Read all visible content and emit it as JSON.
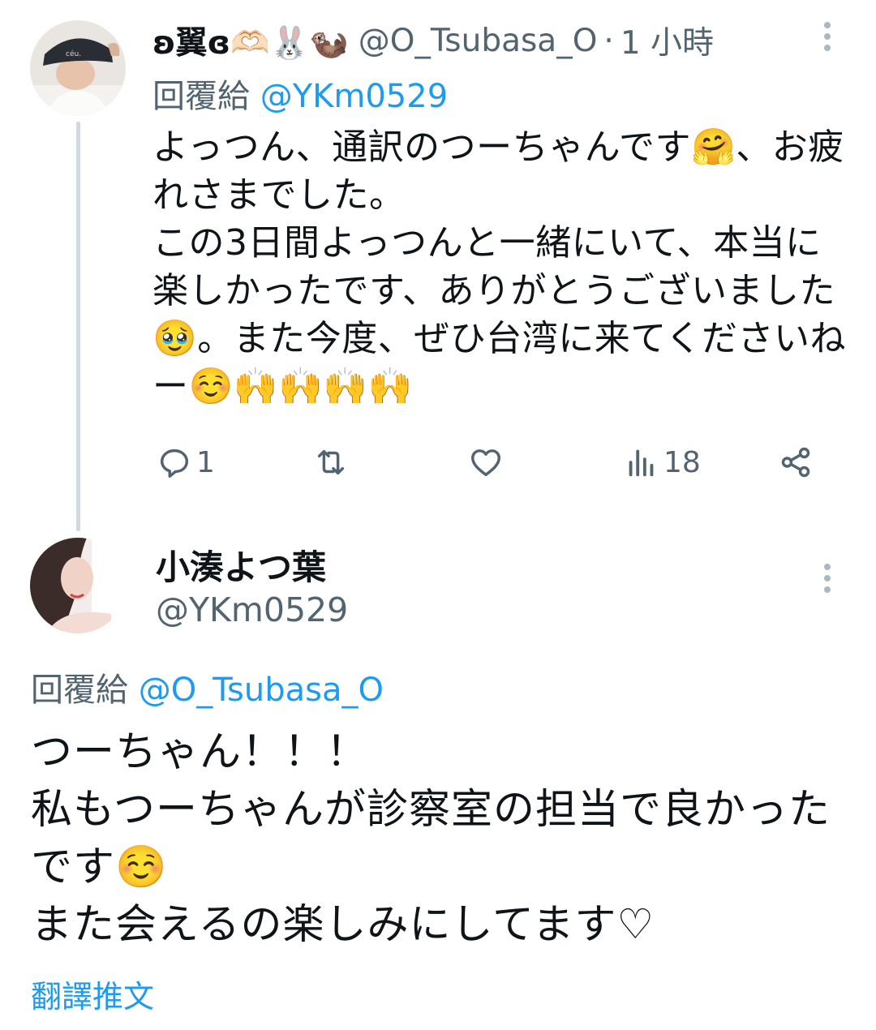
{
  "tweet1": {
    "display_name": "ʚ翼ɞ🫶🏻🐰🦦",
    "handle": "@O_Tsubasa_O",
    "separator": "·",
    "time": "1 小時",
    "reply_prefix": "回覆給",
    "reply_mention": "@YKm0529",
    "text": "よっつん、通訳のつーちゃんです🤗、お疲れさまでした。\nこの3日間よっつんと一緒にいて、本当に楽しかったです、ありがとうございました🥹。また今度、ぜひ台湾に来てくださいねー☺️🙌🙌🙌🙌",
    "actions": {
      "reply_count": "1",
      "retweet_count": "",
      "like_count": "",
      "views_count": "18"
    }
  },
  "tweet2": {
    "display_name": "小湊よつ葉",
    "handle": "@YKm0529",
    "reply_prefix": "回覆給",
    "reply_mention": "@O_Tsubasa_O",
    "text": "つーちゃん！！！\n私もつーちゃんが診察室の担当で良かったです☺️\nまた会えるの楽しみにしてます♡",
    "translate_label": "翻譯推文"
  },
  "colors": {
    "accent": "#1d9bf0",
    "secondary_text": "#536471",
    "primary_text": "#0f1419",
    "thread_line": "#cfd9de"
  },
  "icons": [
    "reply-icon",
    "retweet-icon",
    "like-icon",
    "views-icon",
    "share-icon",
    "more-options-icon"
  ]
}
